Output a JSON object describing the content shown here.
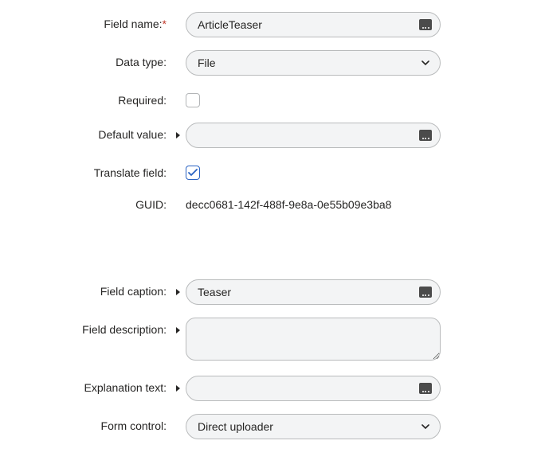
{
  "labels": {
    "fieldName": "Field name:",
    "dataType": "Data type:",
    "required": "Required:",
    "defaultValue": "Default value:",
    "translateField": "Translate field:",
    "guid": "GUID:",
    "fieldCaption": "Field caption:",
    "fieldDescription": "Field description:",
    "explanationText": "Explanation text:",
    "formControl": "Form control:"
  },
  "values": {
    "fieldName": "ArticleTeaser",
    "dataType": "File",
    "defaultValue": "",
    "guid": "decc0681-142f-488f-9e8a-0e55b09e3ba8",
    "fieldCaption": "Teaser",
    "fieldDescription": "",
    "explanationText": "",
    "formControl": "Direct uploader"
  },
  "requiredMarker": "*"
}
